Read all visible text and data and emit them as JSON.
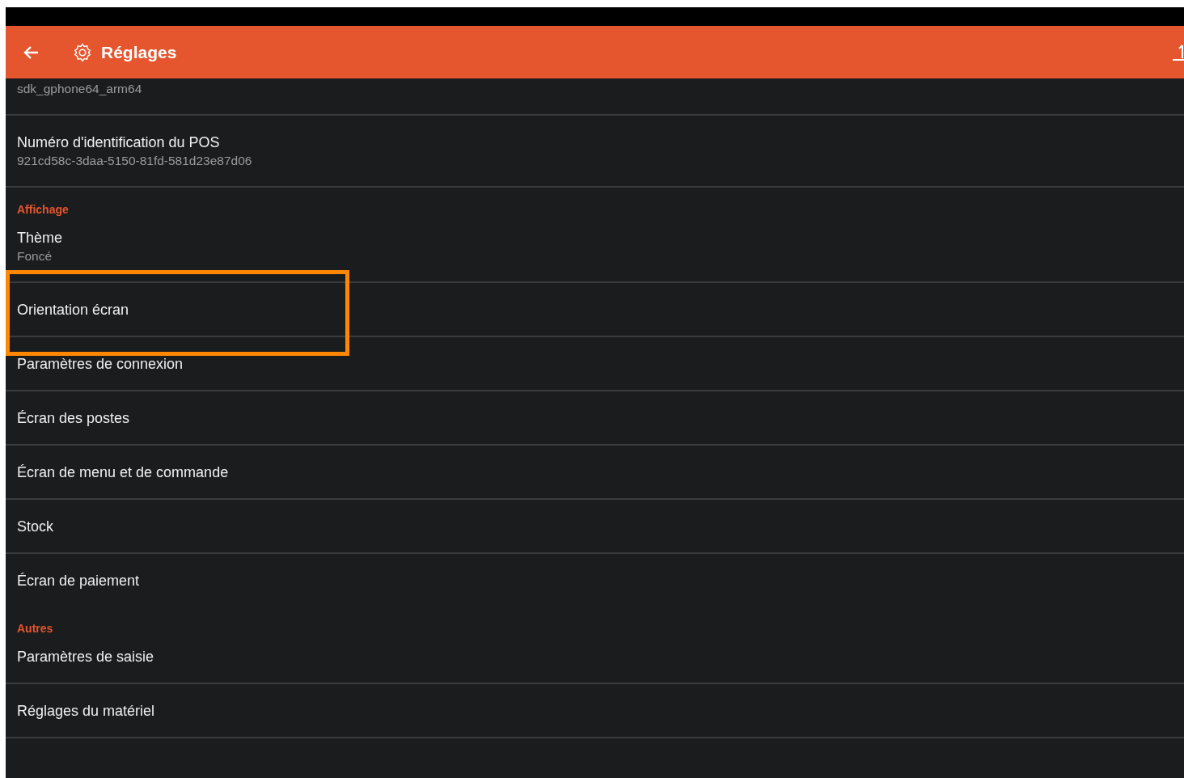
{
  "app_bar": {
    "title": "Réglages"
  },
  "rows": [
    {
      "kind": "summary",
      "subtitle": "sdk_gphone64_arm64",
      "divider": true
    },
    {
      "kind": "pref",
      "title": "Numéro d'identification du POS",
      "subtitle": "921cd58c-3daa-5150-81fd-581d23e87d06",
      "highlighted": false,
      "divider": true
    },
    {
      "kind": "category",
      "title": "Affichage"
    },
    {
      "kind": "pref",
      "title": "Thème",
      "subtitle": "Foncé",
      "highlighted": false,
      "divider": true
    },
    {
      "kind": "pref",
      "title": "Orientation écran",
      "highlighted": true,
      "divider": true
    },
    {
      "kind": "pref",
      "title": "Paramètres de connexion",
      "highlighted": false,
      "divider": true
    },
    {
      "kind": "pref",
      "title": "Écran des postes",
      "highlighted": false,
      "divider": true
    },
    {
      "kind": "pref",
      "title": "Écran de menu et de commande",
      "highlighted": false,
      "divider": true
    },
    {
      "kind": "pref",
      "title": "Stock",
      "highlighted": false,
      "divider": true
    },
    {
      "kind": "pref",
      "title": "Écran de paiement",
      "highlighted": false,
      "divider": false
    },
    {
      "kind": "category",
      "title": "Autres"
    },
    {
      "kind": "pref",
      "title": "Paramètres de saisie",
      "highlighted": false,
      "divider": true
    },
    {
      "kind": "pref",
      "title": "Réglages du matériel",
      "highlighted": false,
      "divider": true
    }
  ]
}
